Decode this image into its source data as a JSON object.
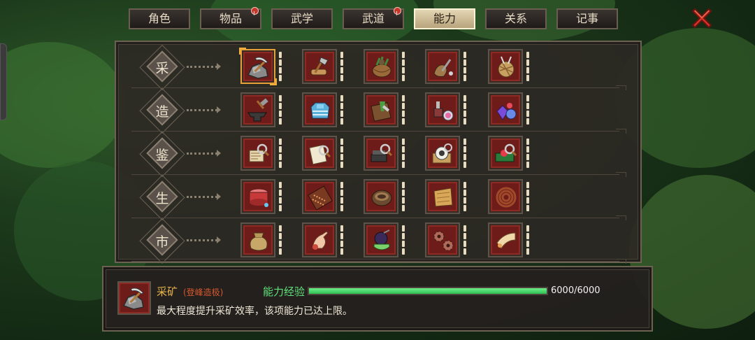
{
  "tabs": [
    {
      "label": "角色",
      "badge": false,
      "active": false
    },
    {
      "label": "物品",
      "badge": true,
      "active": false
    },
    {
      "label": "武学",
      "badge": false,
      "active": false
    },
    {
      "label": "武道",
      "badge": true,
      "active": false
    },
    {
      "label": "能力",
      "badge": false,
      "active": true
    },
    {
      "label": "关系",
      "badge": false,
      "active": false
    },
    {
      "label": "记事",
      "badge": false,
      "active": false
    }
  ],
  "categories": [
    {
      "label": "采",
      "skills": [
        "pickaxe-ore-icon",
        "axe-wood-icon",
        "herb-basket-icon",
        "fishing-pouch-icon",
        "yarn-spool-icon"
      ]
    },
    {
      "label": "造",
      "skills": [
        "anvil-hammer-icon",
        "cloth-armor-icon",
        "chopping-board-icon",
        "potion-mortar-icon",
        "crystal-gems-icon"
      ]
    },
    {
      "label": "鉴",
      "skills": [
        "magnify-scroll-icon",
        "magnify-paper-icon",
        "magnify-rack-icon",
        "magnify-jade-icon",
        "magnify-gem-box-icon"
      ]
    },
    {
      "label": "生",
      "skills": [
        "drum-icon",
        "abacus-icon",
        "bowl-icon",
        "map-cloth-icon",
        "rope-coil-icon"
      ]
    },
    {
      "label": "市",
      "skills": [
        "money-bag-icon",
        "pointing-hand-icon",
        "tea-pot-icon",
        "gear-seal-icon",
        "horn-icon"
      ]
    }
  ],
  "selected": {
    "row": 0,
    "col": 0
  },
  "info": {
    "name": "采矿",
    "rank": "(登峰造极)",
    "description": "最大程度提升采矿效率，该项能力已达上限。",
    "exp_label": "能力经验",
    "exp_current": 6000,
    "exp_max": 6000,
    "exp_text": "6000/6000"
  },
  "colors": {
    "active_tab": "#d8c8a0",
    "badge": "#c2392b",
    "skill_bg": "#6e1c1a",
    "exp_bar": "#4fd86a",
    "skill_name": "#e8b44a",
    "rank": "#d8582e"
  }
}
